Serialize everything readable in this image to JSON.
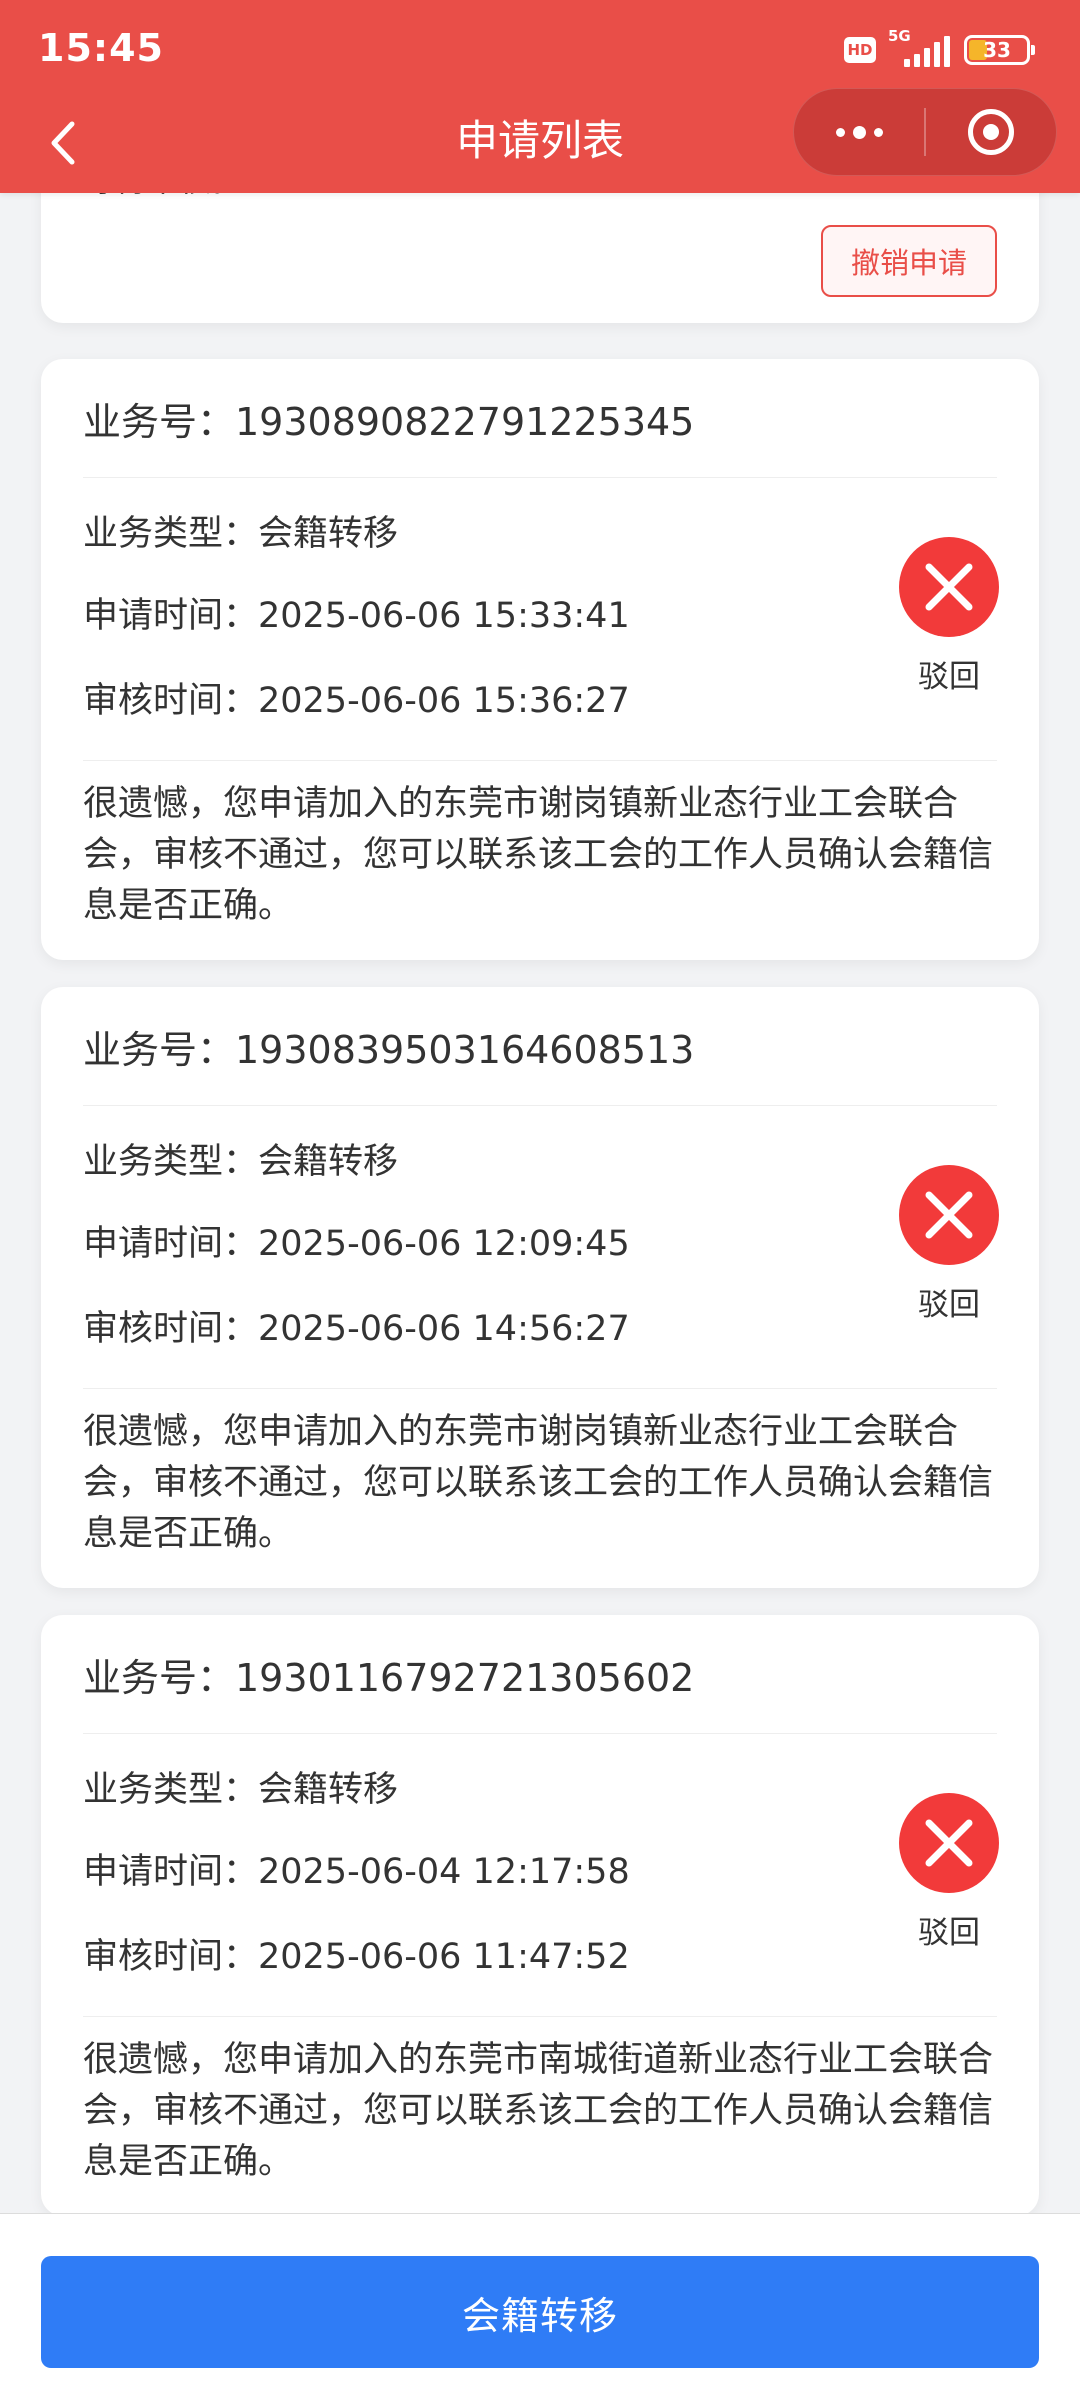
{
  "status_bar": {
    "time": "15:45",
    "hd": "HD",
    "network": "5G",
    "battery": "33"
  },
  "header": {
    "title": "申请列表",
    "back_icon": "chevron-left-icon",
    "menu_icon": "more-dots-icon",
    "close_icon": "target-circle-icon"
  },
  "colors": {
    "header": "#e94e48",
    "reject": "#f23a3a",
    "primary": "#2f7cf6"
  },
  "partial_card": {
    "text": "等待审核。",
    "revoke_label": "撤销申请"
  },
  "cards": [
    {
      "biz_no": "业务号：1930890822791225345",
      "type": "业务类型：会籍转移",
      "apply_time": "申请时间：2025-06-06 15:33:41",
      "review_time": "审核时间：2025-06-06 15:36:27",
      "status": "驳回",
      "message": "很遗憾，您申请加入的东莞市谢岗镇新业态行业工会联合会，审核不通过，您可以联系该工会的工作人员确认会籍信息是否正确。"
    },
    {
      "biz_no": "业务号：1930839503164608513",
      "type": "业务类型：会籍转移",
      "apply_time": "申请时间：2025-06-06 12:09:45",
      "review_time": "审核时间：2025-06-06 14:56:27",
      "status": "驳回",
      "message": "很遗憾，您申请加入的东莞市谢岗镇新业态行业工会联合会，审核不通过，您可以联系该工会的工作人员确认会籍信息是否正确。"
    },
    {
      "biz_no": "业务号：1930116792721305602",
      "type": "业务类型：会籍转移",
      "apply_time": "申请时间：2025-06-04 12:17:58",
      "review_time": "审核时间：2025-06-06 11:47:52",
      "status": "驳回",
      "message": "很遗憾，您申请加入的东莞市南城街道新业态行业工会联合会，审核不通过，您可以联系该工会的工作人员确认会籍信息是否正确。"
    }
  ],
  "footer": {
    "button_label": "会籍转移"
  }
}
